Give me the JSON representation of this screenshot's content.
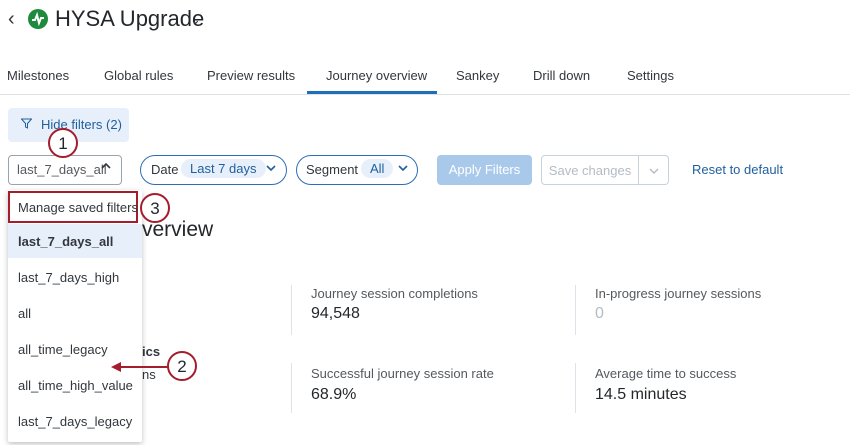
{
  "header": {
    "back_glyph": "‹",
    "logo_icon": "pulse-icon",
    "title": "HYSA Upgrade",
    "title_chevron": "⌄"
  },
  "tabs": [
    {
      "label": "Milestones"
    },
    {
      "label": "Global rules"
    },
    {
      "label": "Preview results"
    },
    {
      "label": "Journey overview",
      "active": true
    },
    {
      "label": "Sankey"
    },
    {
      "label": "Drill down"
    },
    {
      "label": "Settings"
    }
  ],
  "filters": {
    "hide_filters_label": "Hide filters (2)",
    "saved_filter_value": "last_7_days_all",
    "date_label": "Date",
    "date_value": "Last 7 days",
    "segment_label": "Segment",
    "segment_value": "All",
    "apply_label": "Apply Filters",
    "save_label": "Save changes",
    "reset_label": "Reset to default"
  },
  "dropdown": {
    "manage_label": "Manage saved filters",
    "items": [
      {
        "label": "last_7_days_all",
        "selected": true
      },
      {
        "label": "last_7_days_high"
      },
      {
        "label": "all"
      },
      {
        "label": "all_time_legacy"
      },
      {
        "label": "all_time_high_value"
      },
      {
        "label": "last_7_days_legacy"
      }
    ]
  },
  "callouts": [
    "1",
    "2",
    "3"
  ],
  "overview": {
    "title_partial": "verview",
    "metrics_partial": "ics",
    "sessions_partial": "ns",
    "metrics": [
      {
        "label": "Journey session completions",
        "value": "94,548"
      },
      {
        "label": "In-progress journey sessions",
        "value": "0"
      },
      {
        "label": "Successful journey session rate",
        "value": "68.9%"
      },
      {
        "label": "Average time to success",
        "value": "14.5 minutes"
      }
    ]
  },
  "colors": {
    "accent": "#1f6fb8",
    "callout": "#a31d2c",
    "logo": "#1f8a3c"
  }
}
